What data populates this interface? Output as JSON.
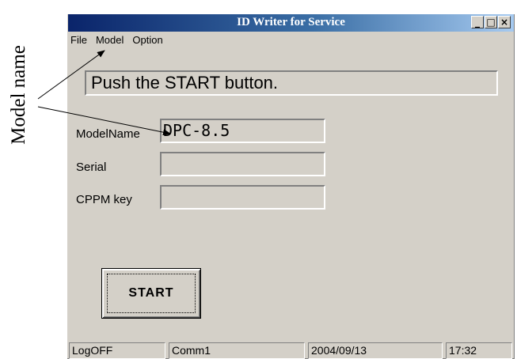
{
  "annotation": {
    "label": "Model name"
  },
  "window": {
    "title": "ID Writer for Service",
    "controls": {
      "minimize": "_",
      "maximize": "□",
      "close": "×"
    }
  },
  "menu": {
    "items": [
      {
        "label": "File",
        "name": "menu-file"
      },
      {
        "label": "Model",
        "name": "menu-model"
      },
      {
        "label": "Option",
        "name": "menu-option"
      }
    ]
  },
  "message": "Push the START button.",
  "fields": {
    "model_name": {
      "label": "ModelName",
      "value": "DPC-8.5"
    },
    "serial": {
      "label": "Serial",
      "value": ""
    },
    "cppm_key": {
      "label": "CPPM key",
      "value": ""
    }
  },
  "start_button": "START",
  "status": {
    "login": "LogOFF",
    "comm": "Comm1",
    "date": "2004/09/13",
    "time": "17:32"
  }
}
